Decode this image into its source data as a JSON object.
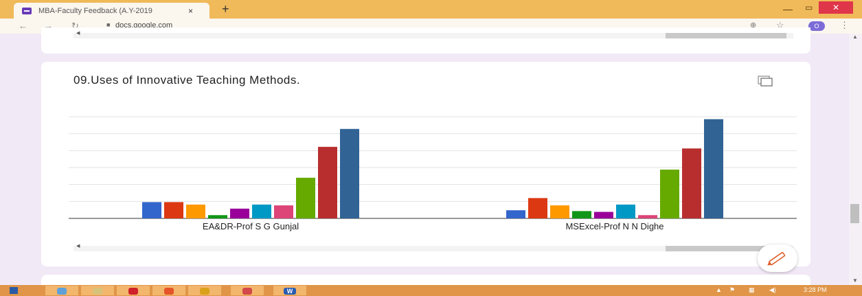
{
  "browser": {
    "tab_title": "MBA-Faculty Feedback (A.Y-2019",
    "tab_close": "×",
    "new_tab": "+",
    "url": "docs.google.com",
    "lock_icon": "lock-icon",
    "profile_initial": "O",
    "window_controls": {
      "minimize": "—",
      "maximize": "▭",
      "close": "✕"
    }
  },
  "question": {
    "title": "09.Uses of Innovative Teaching Methods.",
    "copy_icon": "copy-icon",
    "edit_icon": "pencil-icon"
  },
  "chart_data": {
    "type": "bar",
    "title": "",
    "xlabel": "",
    "ylabel": "",
    "categories": [
      "EA&DR-Prof S G Gunjal",
      "MSExcel-Prof N N Dighe"
    ],
    "series": [
      {
        "color": "#3366cc",
        "values": [
          2,
          1
        ]
      },
      {
        "color": "#dc3912",
        "values": [
          2,
          2.5
        ]
      },
      {
        "color": "#ff9900",
        "values": [
          1.7,
          1.6
        ]
      },
      {
        "color": "#109618",
        "values": [
          0.4,
          0.9
        ]
      },
      {
        "color": "#990099",
        "values": [
          1.2,
          0.8
        ]
      },
      {
        "color": "#0099c6",
        "values": [
          1.7,
          1.7
        ]
      },
      {
        "color": "#dd4477",
        "values": [
          1.6,
          0.4
        ]
      },
      {
        "color": "#66aa00",
        "values": [
          5,
          6
        ]
      },
      {
        "color": "#b82e2e",
        "values": [
          8.8,
          8.6
        ]
      },
      {
        "color": "#316395",
        "values": [
          11,
          12.2
        ]
      }
    ],
    "ylim": [
      0,
      12.5
    ],
    "grid": true,
    "legend": "none"
  },
  "taskbar": {
    "word_label": "W",
    "clock": "3:28 PM"
  }
}
